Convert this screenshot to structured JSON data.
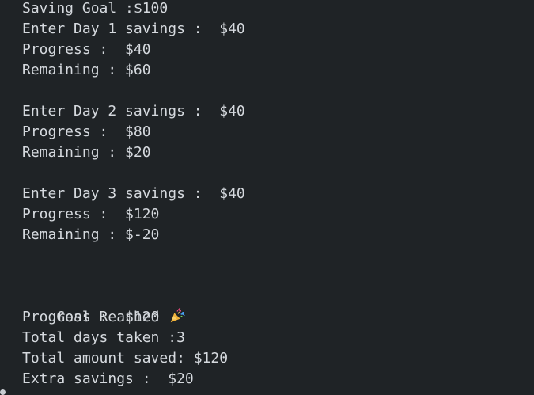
{
  "terminal": {
    "lines": [
      "Saving Goal :$100",
      "Enter Day 1 savings :  $40",
      "Progress :  $40",
      "Remaining : $60",
      "",
      "Enter Day 2 savings :  $40",
      "Progress :  $80",
      "Remaining : $20",
      "",
      "Enter Day 3 savings :  $40",
      "Progress :  $120",
      "Remaining : $-20",
      "",
      "",
      "Goal Reached",
      "Progress :  $120",
      "Total days taken :3",
      "Total amount saved: $120",
      "Extra savings :  $20"
    ],
    "celebration_icon": "party-popper-icon"
  },
  "colors": {
    "background": "#1f2326",
    "text": "#d5d9de"
  }
}
